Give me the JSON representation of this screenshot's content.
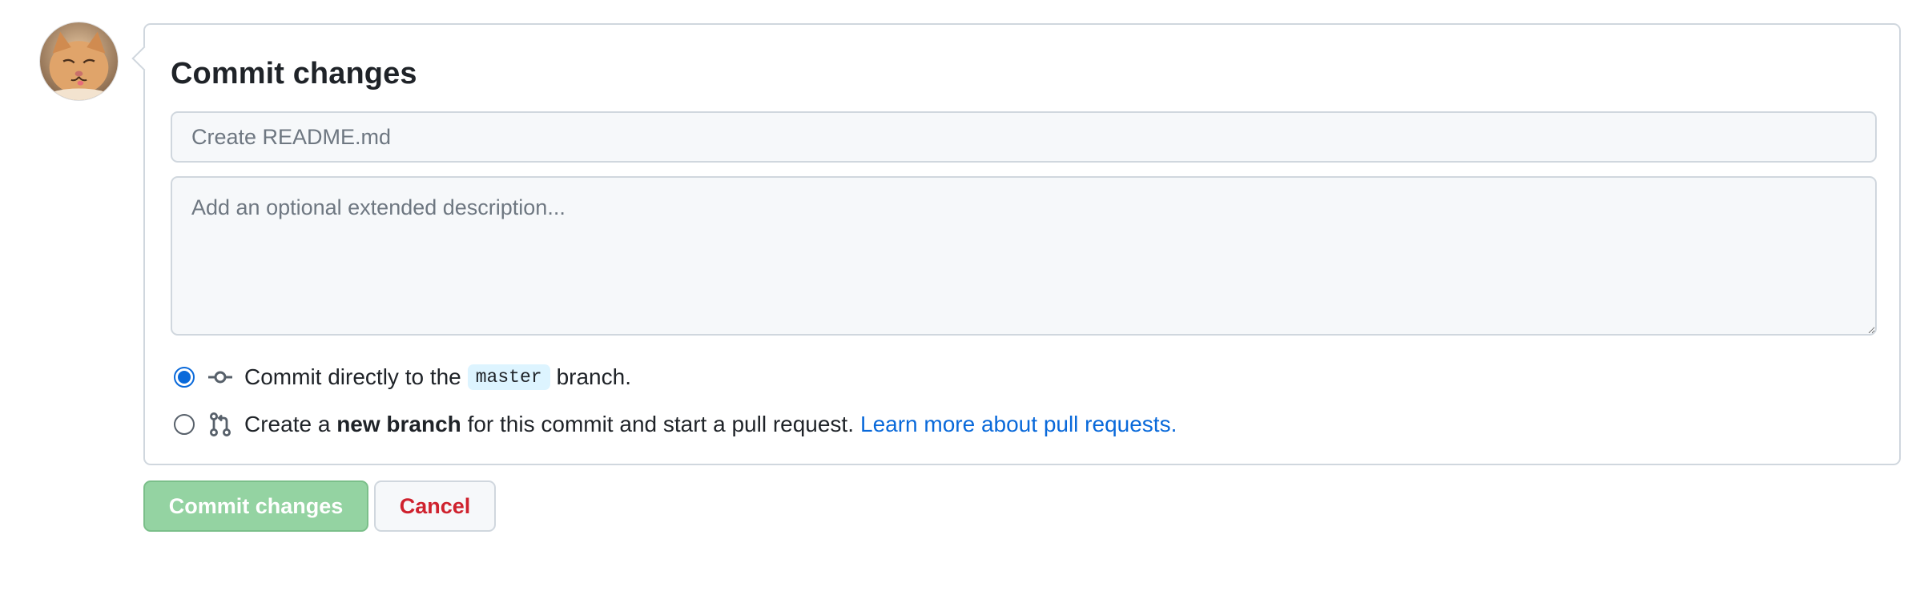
{
  "user": {
    "avatar_icon": "cat-avatar-icon"
  },
  "commit_box": {
    "title": "Commit changes",
    "summary_placeholder": "Create README.md",
    "summary_value": "",
    "description_placeholder": "Add an optional extended description...",
    "description_value": "",
    "options": {
      "direct": {
        "selected": true,
        "icon": "git-commit-icon",
        "prefix": "Commit directly to the",
        "branch": "master",
        "suffix": "branch."
      },
      "new_branch": {
        "selected": false,
        "icon": "git-pull-request-icon",
        "prefix": "Create a",
        "bold": "new branch",
        "suffix": "for this commit and start a pull request.",
        "link": "Learn more about pull requests."
      }
    }
  },
  "actions": {
    "commit_label": "Commit changes",
    "cancel_label": "Cancel"
  },
  "colors": {
    "accent": "#0969da",
    "commit_button_disabled": "#94d3a2",
    "cancel_text": "#cf222e",
    "branch_chip": "#ddf4ff"
  }
}
